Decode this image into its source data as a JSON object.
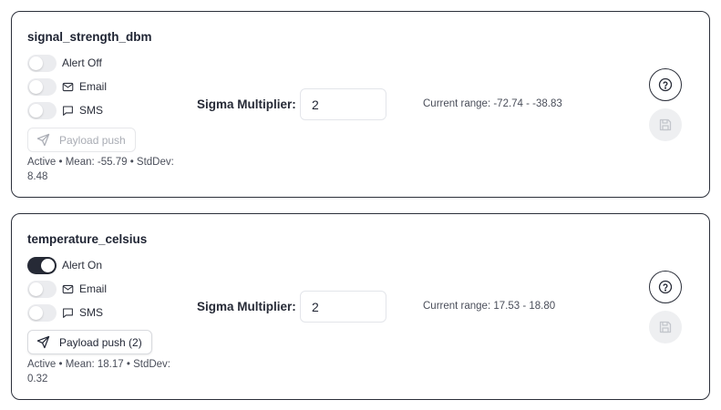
{
  "labels": {
    "sigma": "Sigma Multiplier:",
    "email": "Email",
    "sms": "SMS"
  },
  "icons": {
    "email": "mail-icon",
    "sms": "message-square-icon",
    "payload": "send-icon",
    "help": "help-circle-icon",
    "save": "save-icon"
  },
  "colors": {
    "toggle_on": "#262a36",
    "toggle_off": "#ebecef",
    "card_border": "#2b2f3a",
    "disabled_text": "#a9acb4"
  },
  "metrics": [
    {
      "name": "signal_strength_dbm",
      "alert_on": false,
      "alert_label": "Alert Off",
      "email_on": false,
      "sms_on": false,
      "payload_label": "Payload push",
      "payload_enabled": false,
      "stats": "Active • Mean: -55.79 • StdDev: 8.48",
      "sigma_value": "2",
      "range": "Current range: -72.74 - -38.83",
      "save_enabled": false
    },
    {
      "name": "temperature_celsius",
      "alert_on": true,
      "alert_label": "Alert On",
      "email_on": false,
      "sms_on": false,
      "payload_label": "Payload push (2)",
      "payload_enabled": true,
      "stats": "Active • Mean: 18.17 • StdDev: 0.32",
      "sigma_value": "2",
      "range": "Current range: 17.53 - 18.80",
      "save_enabled": false
    }
  ]
}
